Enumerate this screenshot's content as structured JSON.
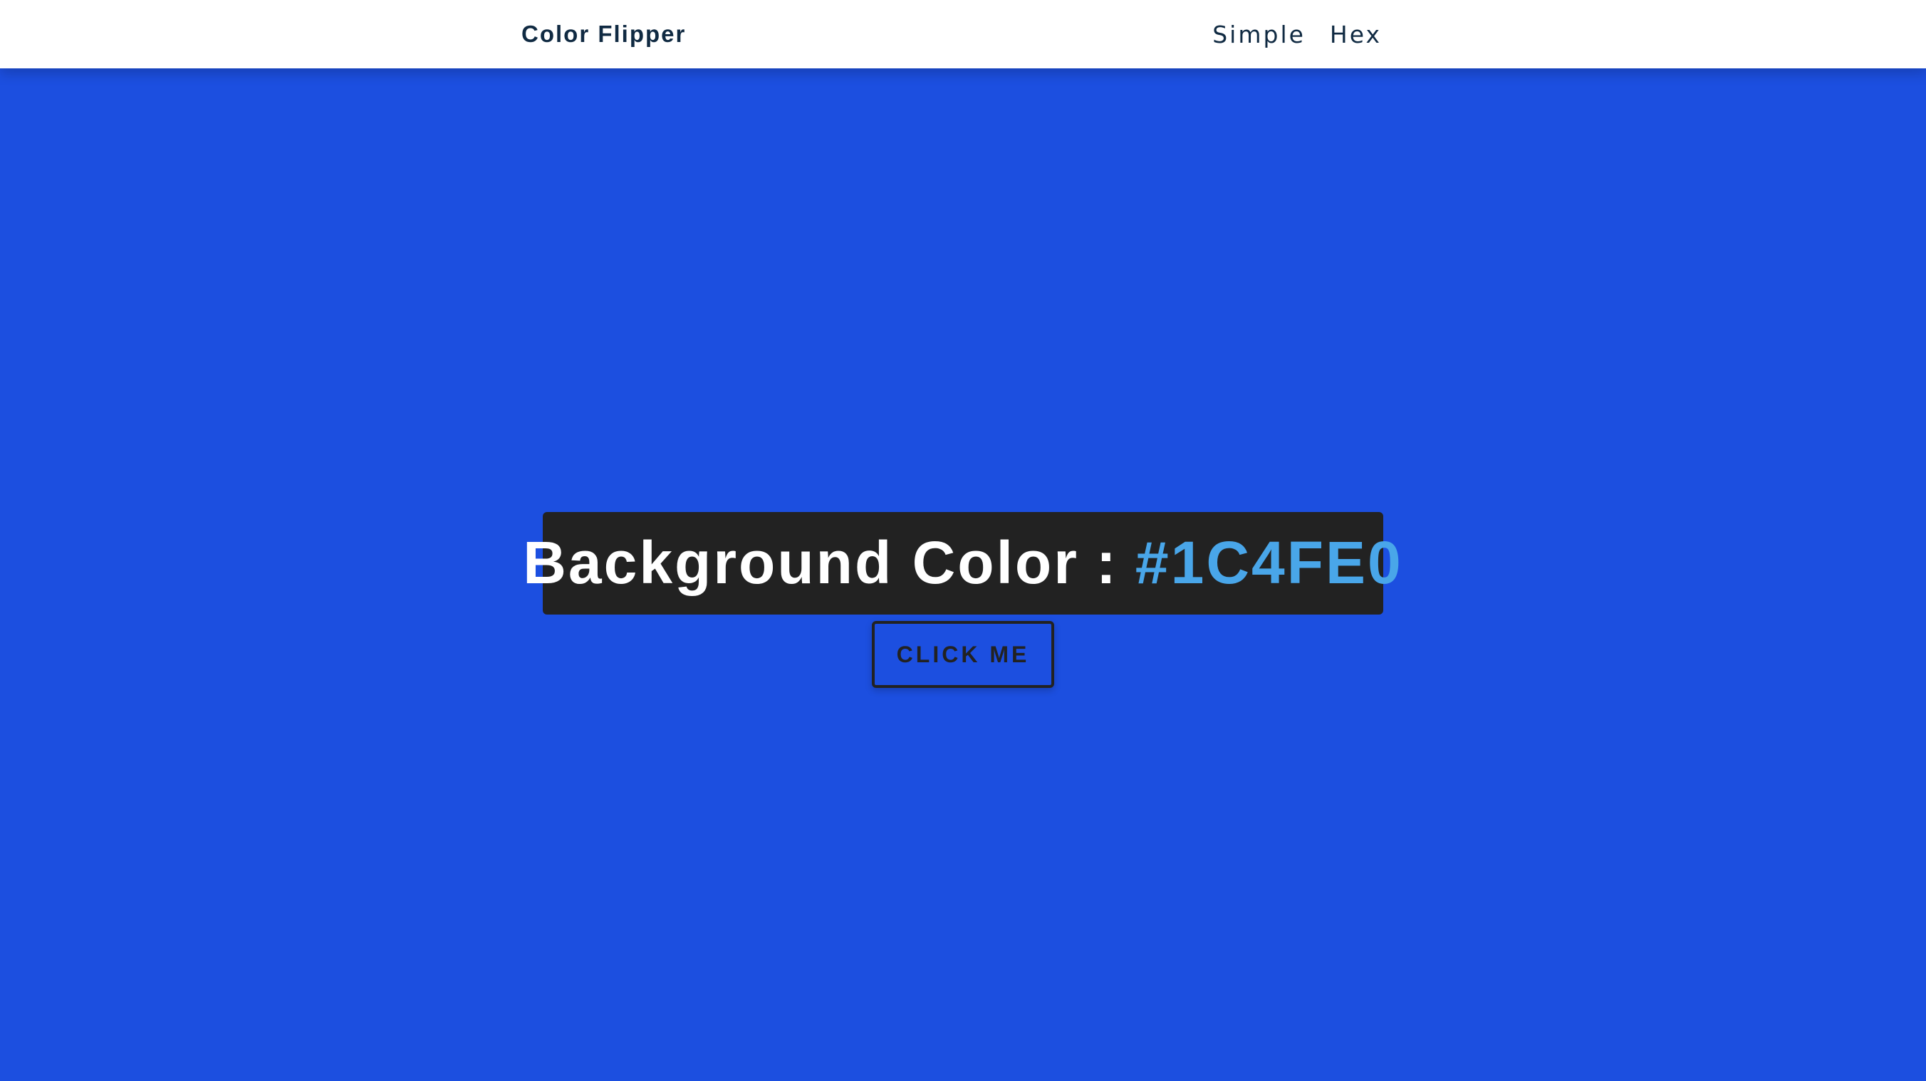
{
  "navbar": {
    "brand": "Color Flipper",
    "links": [
      {
        "label": "Simple"
      },
      {
        "label": "Hex"
      }
    ]
  },
  "main": {
    "label_prefix": "Background Color",
    "label_separator": ":",
    "color_value": "#1C4FE0",
    "button_label": "CLICK ME"
  },
  "colors": {
    "background": "#1C4FE0",
    "navbar_bg": "#ffffff",
    "nav_text": "#102a42",
    "label_bg": "#222222",
    "label_text": "#ffffff",
    "value_text": "#49a6e9",
    "button_border": "#222222"
  }
}
